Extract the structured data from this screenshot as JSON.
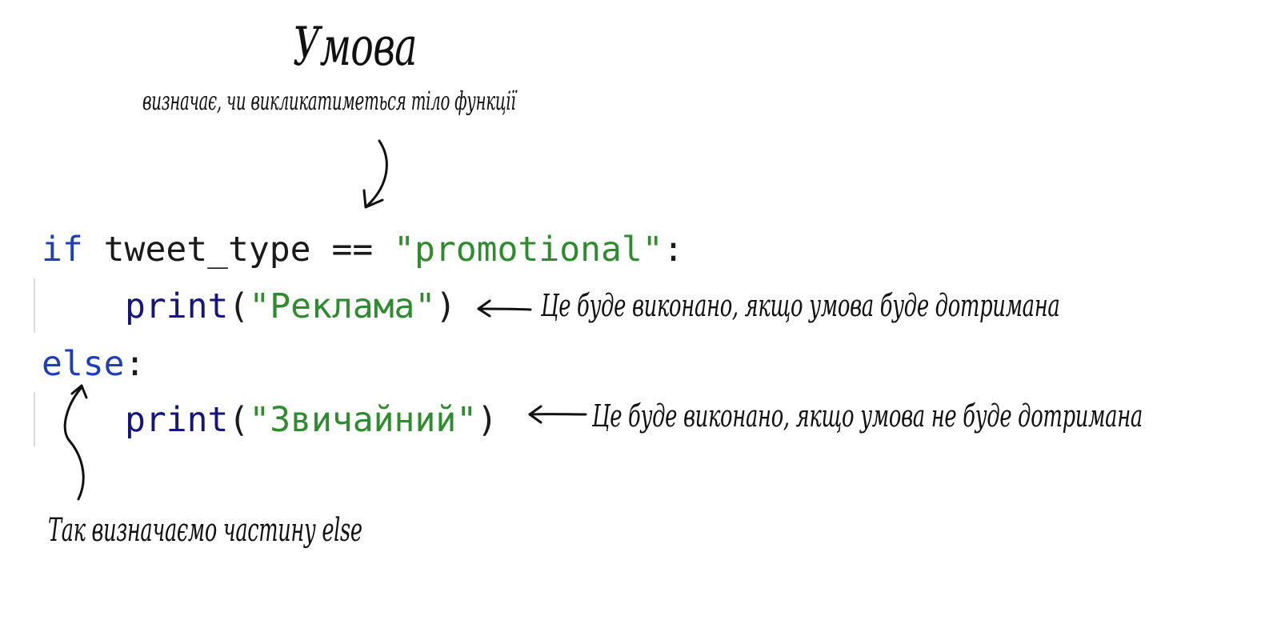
{
  "annotations": {
    "title": "Умова",
    "subtitle": "визначає, чи викликатиметься тіло функції",
    "note_if_true": "Це буде виконано, якщо умова буде дотримана",
    "note_if_false": "Це буде виконано, якщо умова не буде дотримана",
    "note_else": "Так визначаємо частину else"
  },
  "code": {
    "line1": {
      "keyword": "if",
      "expression": " tweet_type == ",
      "string": "\"promotional\"",
      "colon": ":"
    },
    "line2": {
      "function": "print",
      "open": "(",
      "string": "\"Реклама\"",
      "close": ")"
    },
    "line3": {
      "keyword": "else",
      "colon": ":"
    },
    "line4": {
      "function": "print",
      "open": "(",
      "string": "\"Звичайний\"",
      "close": ")"
    }
  },
  "colors": {
    "keyword": "#1f3fb8",
    "function": "#15157a",
    "string": "#2e8b2e",
    "text": "#1a1a1a",
    "annotation": "#111111"
  }
}
